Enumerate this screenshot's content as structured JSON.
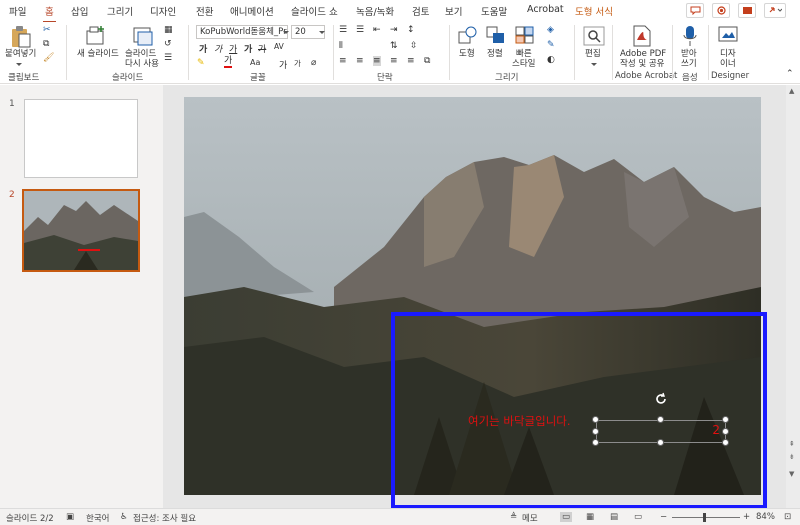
{
  "tabs": [
    {
      "label": "파일",
      "state": "normal"
    },
    {
      "label": "홈",
      "state": "active"
    },
    {
      "label": "삽입",
      "state": "normal"
    },
    {
      "label": "그리기",
      "state": "normal"
    },
    {
      "label": "디자인",
      "state": "normal"
    },
    {
      "label": "전환",
      "state": "normal"
    },
    {
      "label": "애니메이션",
      "state": "normal"
    },
    {
      "label": "슬라이드 쇼",
      "state": "normal"
    },
    {
      "label": "녹음/녹화",
      "state": "normal"
    },
    {
      "label": "검토",
      "state": "normal"
    },
    {
      "label": "보기",
      "state": "normal"
    },
    {
      "label": "도움말",
      "state": "normal"
    },
    {
      "label": "Acrobat",
      "state": "normal"
    },
    {
      "label": "도형 서식",
      "state": "contextual"
    }
  ],
  "ribbon": {
    "clipboard": {
      "paste_label": "붙여넣기",
      "group_label": "클립보드"
    },
    "slides": {
      "new_slide_label": "새 슬라이드",
      "reuse_label_1": "슬라이드",
      "reuse_label_2": "다시 사용",
      "group_label": "슬라이드"
    },
    "font": {
      "font_name": "KoPubWorld돋움체_Pro",
      "font_size": "20",
      "bold": "가",
      "italic": "가",
      "underline": "가",
      "strike": "가",
      "char_spacing": "AV",
      "aa": "가",
      "case": "Aa",
      "grow": "가",
      "shrink": "가",
      "clear": "가",
      "group_label": "글꼴"
    },
    "paragraph": {
      "group_label": "단락"
    },
    "drawing": {
      "shape_label": "도형",
      "arrange_label": "정렬",
      "quick_style_label_1": "빠른",
      "quick_style_label_2": "스타일",
      "group_label": "그리기"
    },
    "editing": {
      "label": "편집"
    },
    "acrobat": {
      "label_1": "Adobe PDF",
      "label_2": "작성 및 공유",
      "group_label": "Adobe Acrobat"
    },
    "voice": {
      "label_1": "받아",
      "label_2": "쓰기",
      "group_label": "음성"
    },
    "designer": {
      "label_1": "디자",
      "label_2": "이너",
      "group_label": "Designer"
    }
  },
  "thumbnails": [
    {
      "number": "1"
    },
    {
      "number": "2"
    }
  ],
  "slide": {
    "caption": "여기는 바닥글입니다.",
    "textbox_number": "2"
  },
  "status": {
    "slide_indicator": "슬라이드 2/2",
    "language": "한국어",
    "accessibility": "접근성: 조사 필요",
    "notes": "메모",
    "zoom": "84%"
  },
  "colors": {
    "accent": "#b7472a",
    "contextual_tab": "#c55a11",
    "selection_outline": "#1a1aff",
    "caption_red": "#e01010"
  }
}
